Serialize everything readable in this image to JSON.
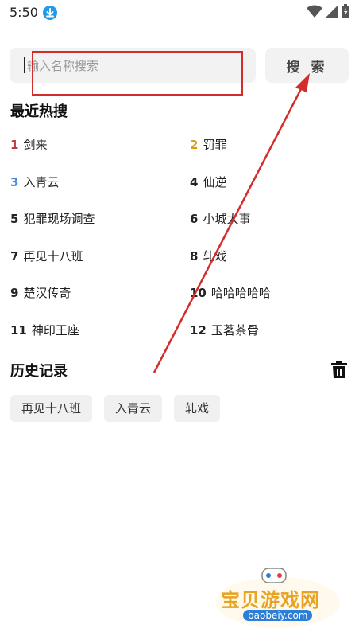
{
  "status_bar": {
    "time": "5:50",
    "icons": [
      "download-icon",
      "wifi-icon",
      "signal-icon",
      "battery-icon"
    ]
  },
  "search": {
    "placeholder": "输入名称搜索",
    "button_label": "搜 索"
  },
  "hot_search": {
    "title": "最近热搜",
    "items": [
      {
        "rank": "1",
        "name": "剑来",
        "rank_color": "#c2393d"
      },
      {
        "rank": "2",
        "name": "罚罪",
        "rank_color": "#d4a018"
      },
      {
        "rank": "3",
        "name": "入青云",
        "rank_color": "#4a8ad8"
      },
      {
        "rank": "4",
        "name": "仙逆",
        "rank_color": "#222222"
      },
      {
        "rank": "5",
        "name": "犯罪现场调查",
        "rank_color": "#222222"
      },
      {
        "rank": "6",
        "name": "小城大事",
        "rank_color": "#222222"
      },
      {
        "rank": "7",
        "name": "再见十八班",
        "rank_color": "#222222"
      },
      {
        "rank": "8",
        "name": "轧戏",
        "rank_color": "#222222"
      },
      {
        "rank": "9",
        "name": "楚汉传奇",
        "rank_color": "#222222"
      },
      {
        "rank": "10",
        "name": "哈哈哈哈哈",
        "rank_color": "#222222"
      },
      {
        "rank": "11",
        "name": "神印王座",
        "rank_color": "#222222"
      },
      {
        "rank": "12",
        "name": "玉茗茶骨",
        "rank_color": "#222222"
      }
    ]
  },
  "history": {
    "title": "历史记录",
    "items": [
      "再见十八班",
      "入青云",
      "轧戏"
    ]
  },
  "watermark": {
    "text": "宝贝游戏网",
    "url": "baobeiy.com"
  },
  "colors": {
    "annotation": "#d42b2b",
    "background": "#ffffff",
    "chip_bg": "#f0f0f0"
  }
}
